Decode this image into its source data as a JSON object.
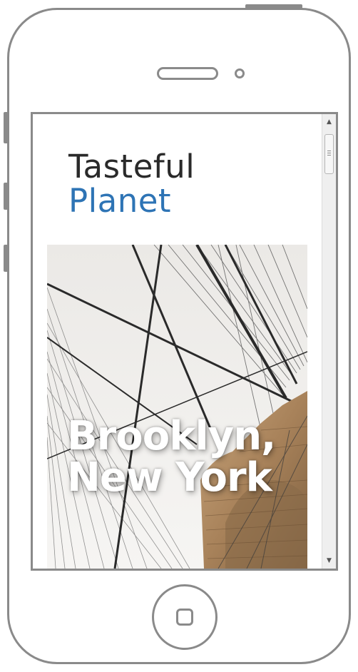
{
  "brand": {
    "line1": "Tasteful",
    "line2": "Planet"
  },
  "hero": {
    "title_line1": "Brooklyn,",
    "title_line2": "New York"
  },
  "scrollbar": {
    "up_icon": "scroll-up-arrow",
    "down_icon": "scroll-down-arrow",
    "up_glyph": "▲",
    "down_glyph": "▼"
  },
  "colors": {
    "brand_dark": "#2a2a2a",
    "brand_blue": "#2e74b5",
    "phone_frame": "#8a8a8a"
  }
}
